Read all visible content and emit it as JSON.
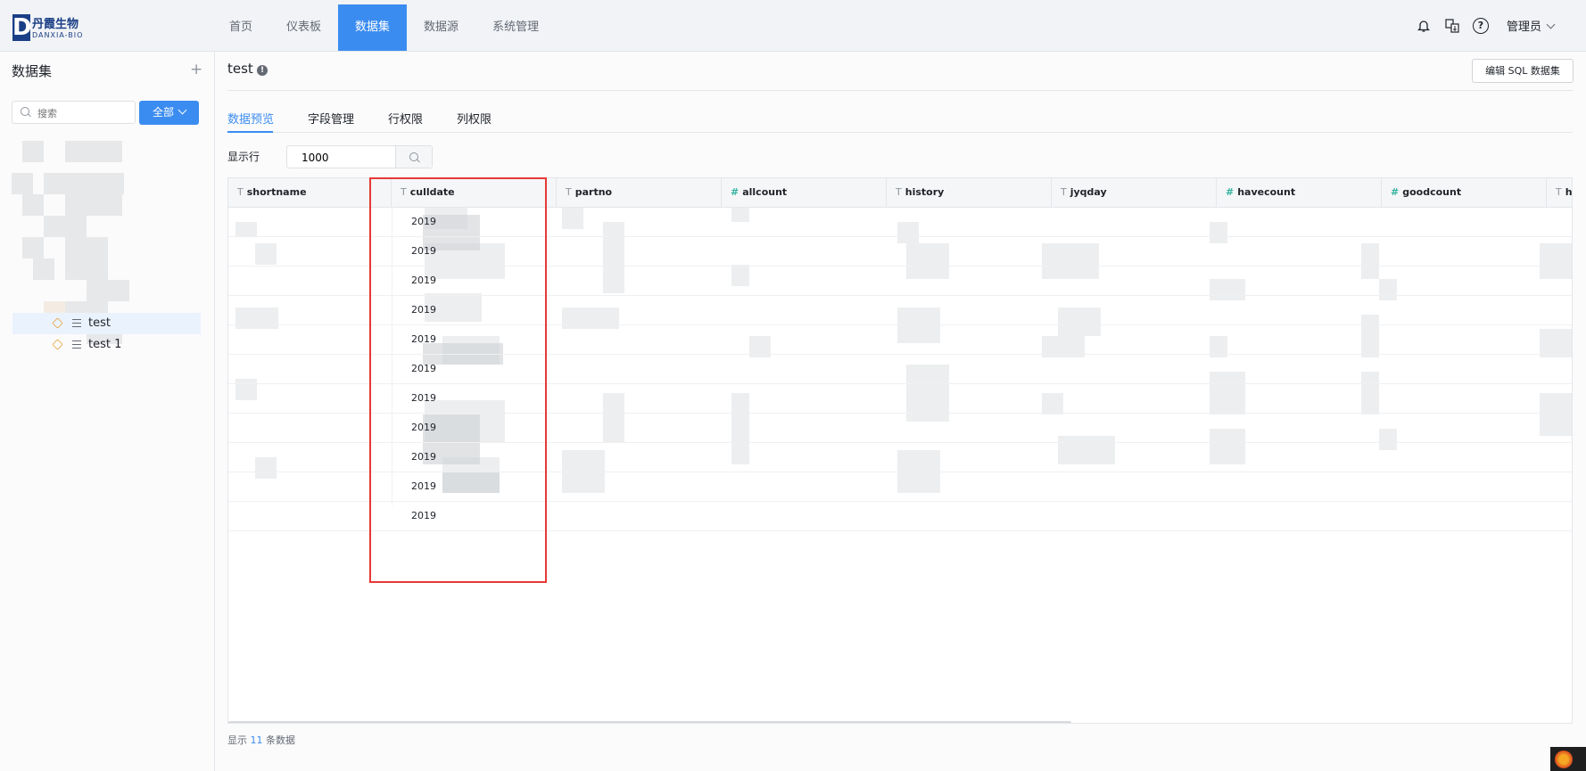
{
  "brand": {
    "logo_letter": "D",
    "name_cn": "丹霞生物",
    "name_en": "DANXIA-BIO"
  },
  "nav": {
    "items": [
      "首页",
      "仪表板",
      "数据集",
      "数据源",
      "系统管理"
    ],
    "active_index": 2
  },
  "header_right": {
    "user": "管理员",
    "help": "?"
  },
  "sidebar": {
    "title": "数据集",
    "add_symbol": "+",
    "search_placeholder": "搜索",
    "filter_label": "全部",
    "tree": [
      "test",
      "test 1"
    ],
    "selected_index": 0
  },
  "main": {
    "dataset_name": "test",
    "edit_sql_button": "编辑 SQL 数据集",
    "tabs": [
      "数据预览",
      "字段管理",
      "行权限",
      "列权限"
    ],
    "active_tab": 0,
    "rows_label": "显示行",
    "rows_value": "1000"
  },
  "table": {
    "columns": [
      {
        "name": "shortname",
        "type": "text"
      },
      {
        "name": "culldate",
        "type": "text"
      },
      {
        "name": "partno",
        "type": "text"
      },
      {
        "name": "allcount",
        "type": "number"
      },
      {
        "name": "history",
        "type": "text"
      },
      {
        "name": "jyqday",
        "type": "text"
      },
      {
        "name": "havecount",
        "type": "number"
      },
      {
        "name": "goodcount",
        "type": "number"
      },
      {
        "name": "h",
        "type": "text"
      }
    ],
    "text_type_icon": "T",
    "number_type_icon": "#",
    "culldate_values": [
      "2019",
      "2019",
      "2019",
      "2019",
      "2019",
      "2019",
      "2019",
      "2019",
      "2019",
      "2019",
      "2019"
    ]
  },
  "footer": {
    "prefix": "显示",
    "count": "11",
    "suffix": "条数据"
  },
  "colors": {
    "accent": "#3b8cf0",
    "highlight_box": "#e53935",
    "number_type": "#34b3a0"
  }
}
